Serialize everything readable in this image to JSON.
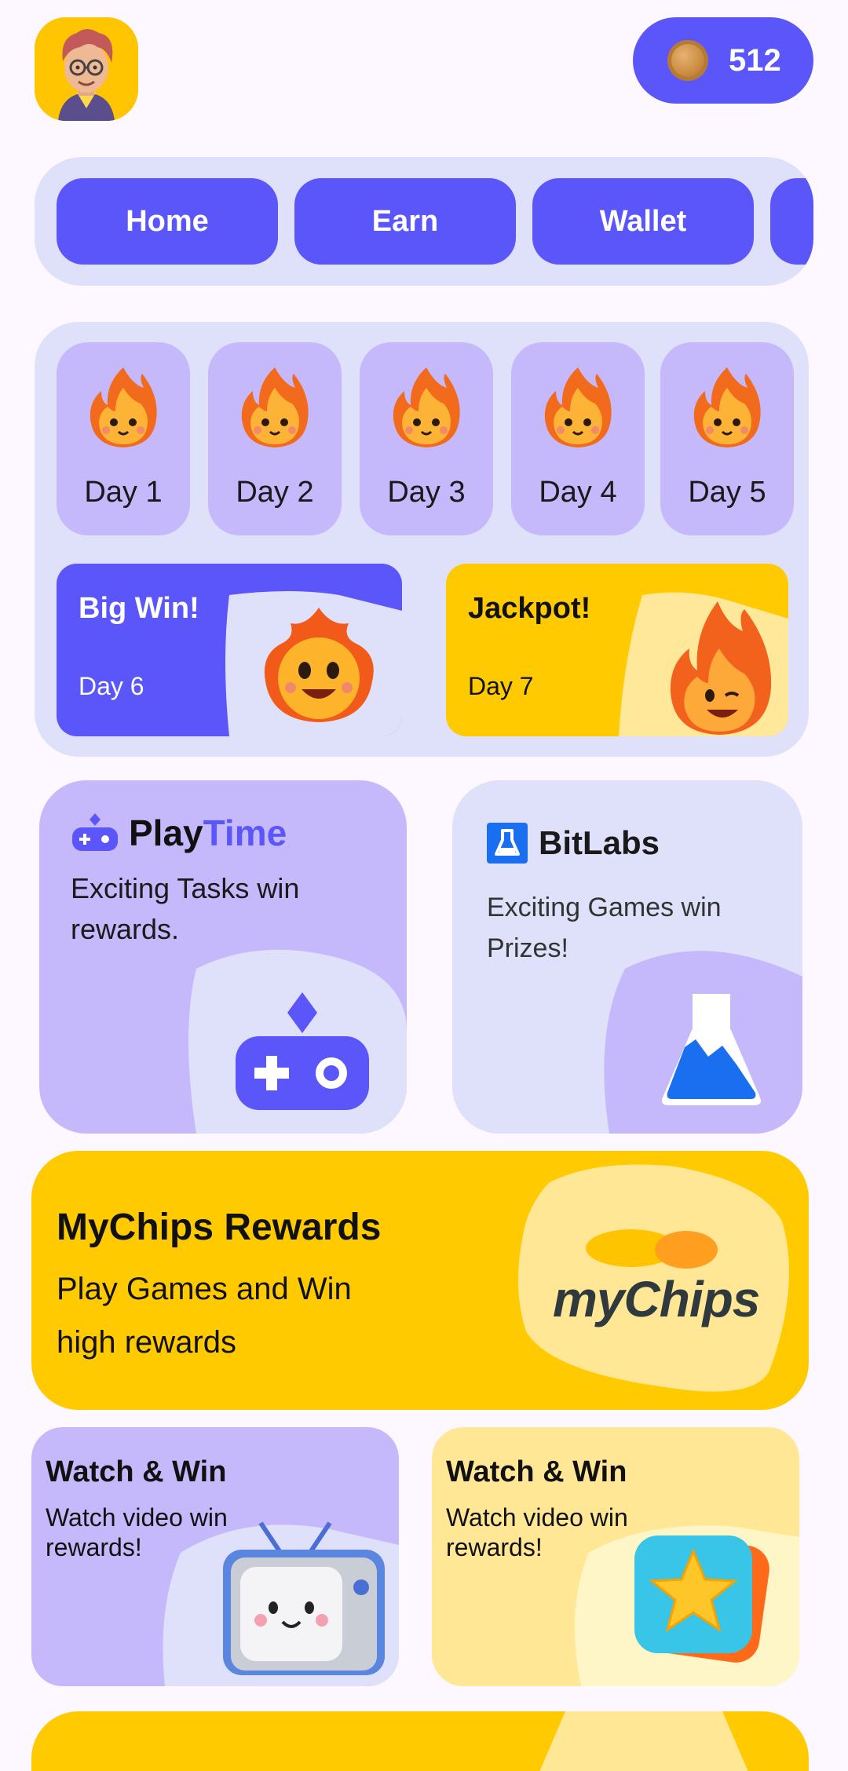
{
  "header": {
    "avatar_icon": "avatar-icon",
    "coin_icon": "coin-icon",
    "coin_count": "512"
  },
  "nav": {
    "items": [
      {
        "label": "Home"
      },
      {
        "label": "Earn"
      },
      {
        "label": "Wallet"
      }
    ]
  },
  "streak": {
    "days": [
      {
        "label": "Day 1"
      },
      {
        "label": "Day 2"
      },
      {
        "label": "Day 3"
      },
      {
        "label": "Day 4"
      },
      {
        "label": "Day 5"
      }
    ],
    "big_win": {
      "title": "Big Win!",
      "day": "Day 6"
    },
    "jackpot": {
      "title": "Jackpot!",
      "day": "Day 7"
    }
  },
  "partners": {
    "playtime": {
      "brand_play": "Play",
      "brand_time": "Time",
      "description": "Exciting Tasks win rewards."
    },
    "bitlabs": {
      "brand": "BitLabs",
      "description": "Exciting Games win Prizes!"
    }
  },
  "mychips": {
    "title": "MyChips Rewards",
    "description_line1": "Play Games and Win",
    "description_line2": "high rewards",
    "logo_text": "myChips"
  },
  "watch_cards": [
    {
      "title": "Watch & Win",
      "description": "Watch video win rewards!"
    },
    {
      "title": "Watch & Win",
      "description": "Watch video win rewards!"
    }
  ],
  "colors": {
    "accent": "#5B56FA",
    "yellow": "#FFCB00",
    "lavender": "#C5B9FC",
    "panel": "#DFE0FA",
    "background": "#FDF7FF"
  }
}
